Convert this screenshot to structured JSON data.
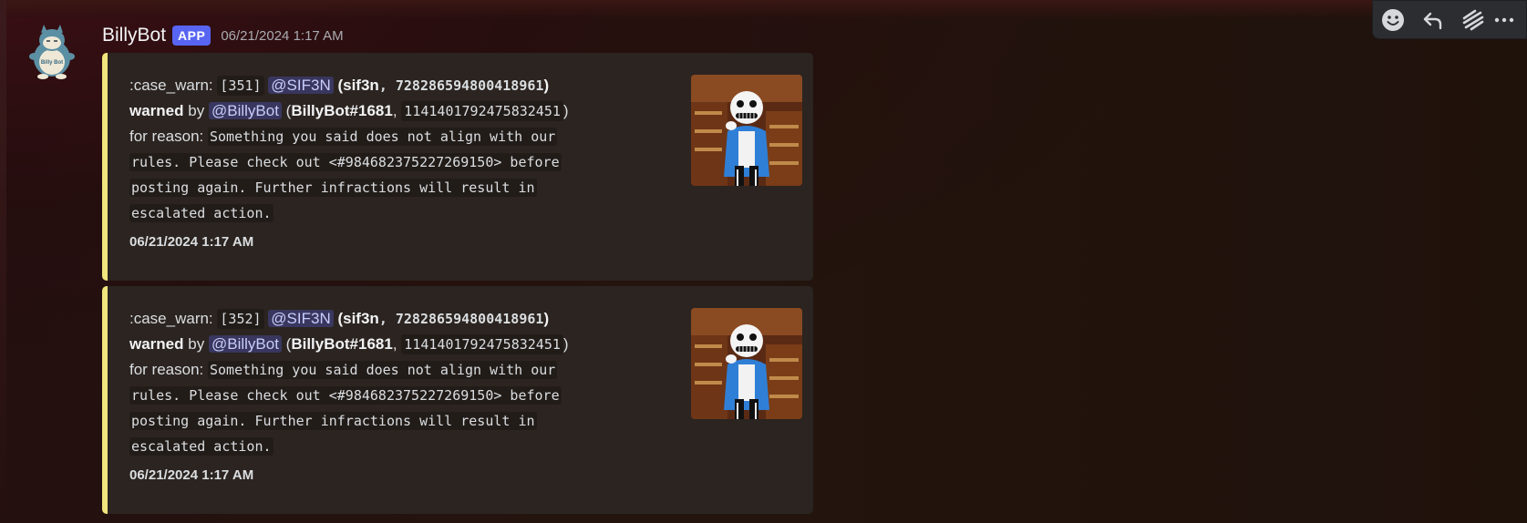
{
  "message": {
    "username": "BillyBot",
    "badge": "APP",
    "timestamp": "06/21/2024 1:17 AM",
    "avatar_text": "Billy Bot"
  },
  "embeds": [
    {
      "case_prefix": ":case_warn:",
      "case_number": "[351]",
      "target_mention": "@SIF3N",
      "target_open": "(sif3n",
      "target_id": ", 728286594800418961",
      "target_close": ")",
      "action": "warned",
      "by_text": "by",
      "mod_mention": "@BillyBot",
      "mod_open": "(",
      "mod_tag": "BillyBot#1681",
      "mod_sep": ",",
      "mod_id": "1141401792475832451",
      "mod_close": ")",
      "reason_label": "for reason:",
      "reason_lines": [
        "Something you said does not align with our",
        "rules. Please check out <#984682375227269150> before",
        "posting again. Further infractions will result in",
        "escalated action."
      ],
      "footer": "06/21/2024 1:17 AM"
    },
    {
      "case_prefix": ":case_warn:",
      "case_number": "[352]",
      "target_mention": "@SIF3N",
      "target_open": "(sif3n",
      "target_id": ", 728286594800418961",
      "target_close": ")",
      "action": "warned",
      "by_text": "by",
      "mod_mention": "@BillyBot",
      "mod_open": "(",
      "mod_tag": "BillyBot#1681",
      "mod_sep": ",",
      "mod_id": "1141401792475832451",
      "mod_close": ")",
      "reason_label": "for reason:",
      "reason_lines": [
        "Something you said does not align with our",
        "rules. Please check out <#984682375227269150> before",
        "posting again. Further infractions will result in",
        "escalated action."
      ],
      "footer": "06/21/2024 1:17 AM"
    }
  ],
  "toolbar": {
    "icons": [
      "add-reaction-icon",
      "reply-icon",
      "thread-icon",
      "more-icon"
    ]
  },
  "colors": {
    "embed_border": "#f0e57e",
    "app_badge": "#5865f2",
    "embed_bg": "#2b2420",
    "mention_bg": "#3d4270"
  }
}
